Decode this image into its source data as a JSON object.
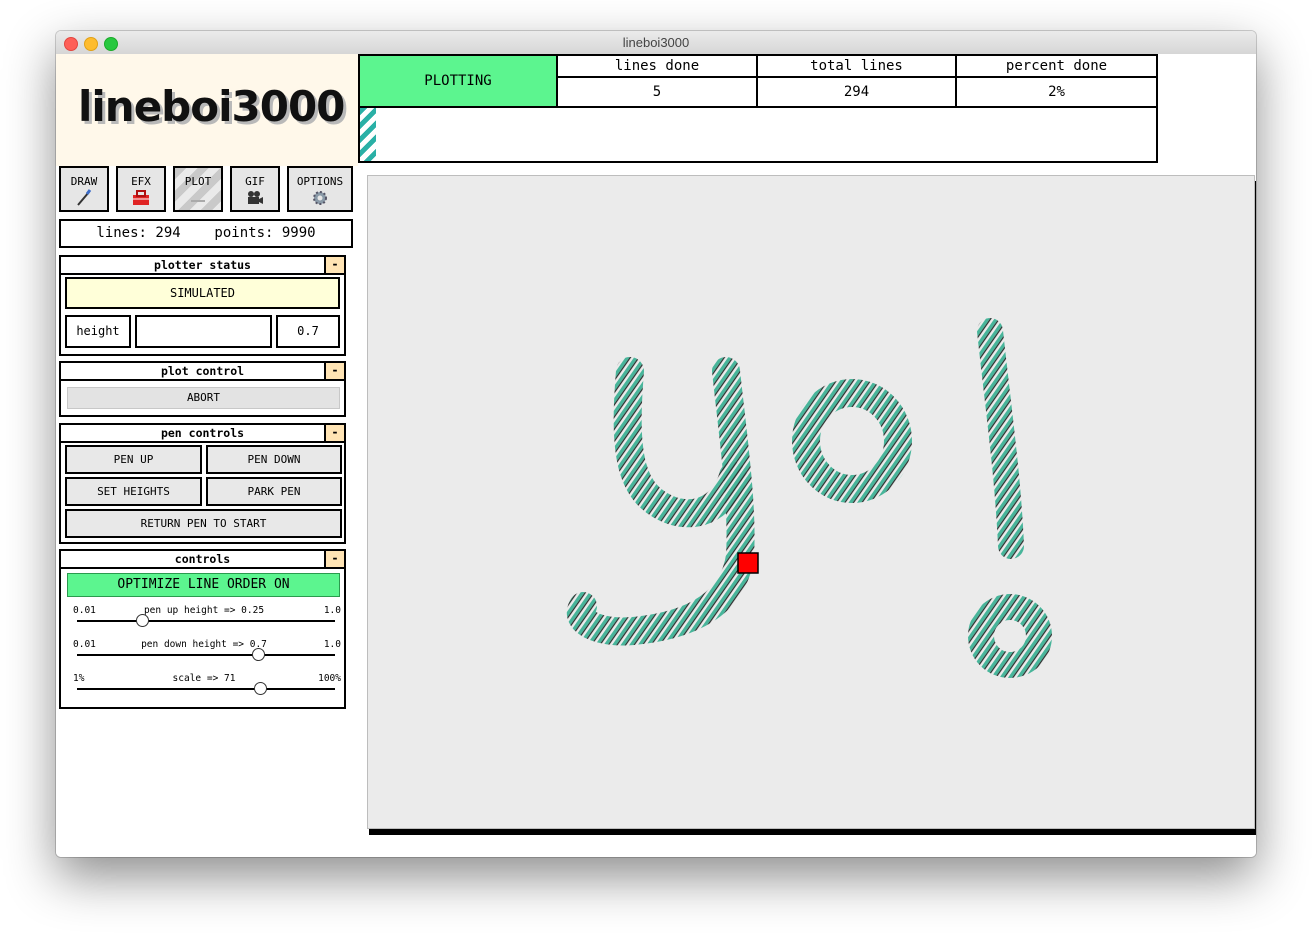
{
  "window": {
    "title": "lineboi3000"
  },
  "logo": "lineboi3000",
  "tabs": [
    {
      "label": "DRAW",
      "icon": "paintbrush-icon",
      "active": false
    },
    {
      "label": "EFX",
      "icon": "toolbox-icon",
      "active": false
    },
    {
      "label": "PLOT",
      "icon": "plot-icon",
      "active": true
    },
    {
      "label": "GIF",
      "icon": "camera-icon",
      "active": false
    },
    {
      "label": "OPTIONS",
      "icon": "gear-icon",
      "active": false
    }
  ],
  "stats": {
    "lines_label": "lines:",
    "lines_value": "294",
    "points_label": "points:",
    "points_value": "9990"
  },
  "plotter_status": {
    "title": "plotter status",
    "collapse": "-",
    "status": "SIMULATED",
    "height_label": "height",
    "height_value": "0.7"
  },
  "plot_control": {
    "title": "plot control",
    "collapse": "-",
    "abort": "ABORT"
  },
  "pen_controls": {
    "title": "pen controls",
    "collapse": "-",
    "pen_up": "PEN UP",
    "pen_down": "PEN DOWN",
    "set_heights": "SET HEIGHTS",
    "park_pen": "PARK PEN",
    "return_pen": "RETURN PEN TO START"
  },
  "controls": {
    "title": "controls",
    "collapse": "-",
    "optimize": "OPTIMIZE LINE ORDER ON",
    "sliders": [
      {
        "min": "0.01",
        "max": "1.0",
        "label": "pen up height => 0.25",
        "fraction": 0.25
      },
      {
        "min": "0.01",
        "max": "1.0",
        "label": "pen down height => 0.7",
        "fraction": 0.7
      },
      {
        "min": "1%",
        "max": "100%",
        "label": "scale => 71",
        "fraction": 0.71
      }
    ]
  },
  "status_table": {
    "state": "PLOTTING",
    "lines_done_label": "lines done",
    "lines_done": "5",
    "total_lines_label": "total lines",
    "total_lines": "294",
    "percent_done_label": "percent done",
    "percent_done": "2%",
    "progress_fraction": 0.02
  },
  "canvas": {
    "hatch_color": "#48b59a",
    "pen_color": "#ff0000"
  }
}
